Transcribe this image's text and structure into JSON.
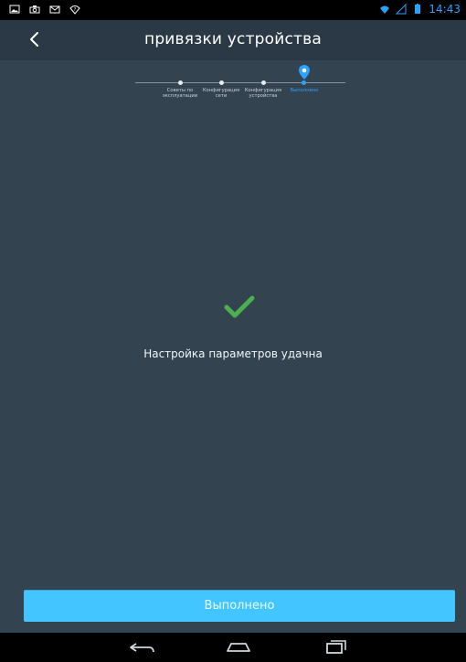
{
  "status_bar": {
    "time": "14:43",
    "left_icons": [
      "gallery-icon",
      "camera-icon",
      "gmail-icon",
      "wifi-question-icon"
    ],
    "right_icons": [
      "wifi-icon",
      "signal-icon",
      "battery-icon"
    ],
    "accent_color": "#2aa2ff"
  },
  "header": {
    "title": "привязки устройства",
    "back_icon": "chevron-left-icon"
  },
  "stepper": {
    "steps": [
      {
        "label": "Советы по\nэксплуатации",
        "state": "done"
      },
      {
        "label": "Конфигурация\nсети",
        "state": "done"
      },
      {
        "label": "Конфигурация\nустройства",
        "state": "done"
      },
      {
        "label": "Выполнено",
        "state": "active"
      }
    ],
    "active_color": "#2aa2ff"
  },
  "result": {
    "icon": "checkmark-icon",
    "icon_color": "#4caf50",
    "message": "Настройка параметров удачна"
  },
  "footer": {
    "done_button_label": "Выполнено",
    "button_color": "#43c6ff"
  },
  "nav_bar": {
    "icons": [
      "back-nav-icon",
      "home-nav-icon",
      "recents-nav-icon"
    ]
  }
}
